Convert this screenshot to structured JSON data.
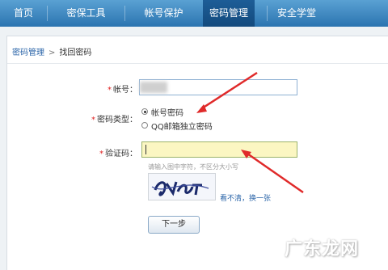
{
  "nav": {
    "items": [
      "首页",
      "密保工具",
      "帐号保护",
      "密码管理",
      "安全学堂"
    ],
    "active": "密码管理"
  },
  "breadcrumb": {
    "parent": "密码管理",
    "separator": ">",
    "current": "找回密码"
  },
  "form": {
    "required_mark": "*",
    "account_label": "帐号：",
    "password_type_label": "密码类型：",
    "options": [
      "帐号密码",
      "QQ邮箱独立密码"
    ],
    "selected_option": "帐号密码",
    "captcha_label": "验证码：",
    "captcha_hint": "请输入图中字符，不区分大小写",
    "refresh_link": "看不清，换一张",
    "next_button": "下一步"
  },
  "watermark": "广东龙网",
  "colors": {
    "nav_top": "#5aa1d3",
    "nav_bottom": "#2b74b0",
    "active_tab": "#1d5d97",
    "arrow": "#e02a2a",
    "captcha_field": "#fbf6c2",
    "link": "#2a64a8"
  }
}
